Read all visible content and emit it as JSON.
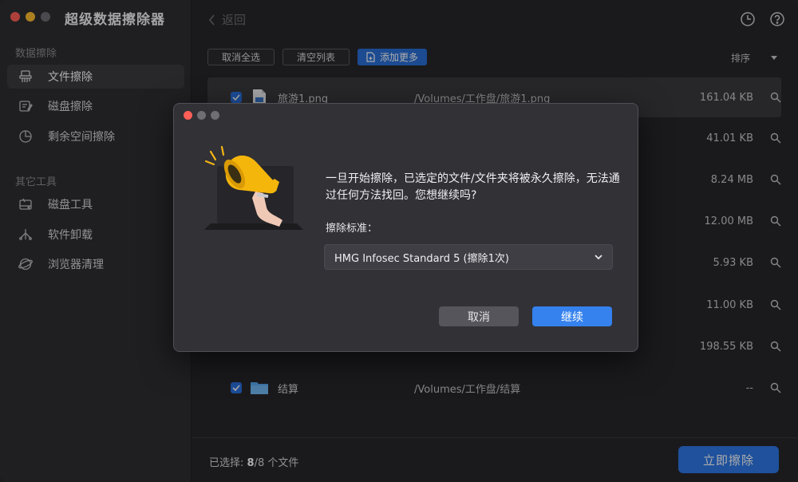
{
  "app": {
    "title": "超级数据擦除器"
  },
  "sidebar": {
    "section1": "数据擦除",
    "items1": [
      {
        "label": "文件擦除",
        "icon": "shredder-icon",
        "active": true
      },
      {
        "label": "磁盘擦除",
        "icon": "disk-erase-icon",
        "active": false
      },
      {
        "label": "剩余空间擦除",
        "icon": "pie-chart-icon",
        "active": false
      }
    ],
    "section2": "其它工具",
    "items2": [
      {
        "label": "磁盘工具",
        "icon": "disk-tool-icon"
      },
      {
        "label": "软件卸载",
        "icon": "uninstall-icon"
      },
      {
        "label": "浏览器清理",
        "icon": "browser-clean-icon"
      }
    ]
  },
  "topbar": {
    "back_label": "返回"
  },
  "toolbar": {
    "deselect_all": "取消全选",
    "clear_list": "清空列表",
    "add_more": "添加更多",
    "sort": "排序"
  },
  "files": [
    {
      "name": "旅游1.png",
      "path": "/Volumes/工作盘/旅游1.png",
      "size": "161.04 KB",
      "type": "image"
    },
    {
      "name": "",
      "path": "",
      "size": "41.01 KB",
      "type": "hidden"
    },
    {
      "name": "",
      "path": "",
      "size": "8.24 MB",
      "type": "hidden"
    },
    {
      "name": "",
      "path": "",
      "size": "12.00 MB",
      "type": "hidden"
    },
    {
      "name": "",
      "path": "",
      "size": "5.93 KB",
      "type": "hidden"
    },
    {
      "name": "",
      "path": "",
      "size": "11.00 KB",
      "type": "hidden"
    },
    {
      "name": "",
      "path": "",
      "size": "198.55 KB",
      "type": "hidden"
    },
    {
      "name": "结算",
      "path": "/Volumes/工作盘/结算",
      "size": "--",
      "type": "folder"
    }
  ],
  "footer": {
    "selected_prefix": "已选择: ",
    "selected_count": "8",
    "selected_suffix": "/8 个文件",
    "erase_button": "立即擦除"
  },
  "dialog": {
    "message": "一旦开始擦除，已选定的文件/文件夹将被永久擦除，无法通过任何方法找回。您想继续吗?",
    "standard_label": "擦除标准：",
    "standard_value": "HMG Infosec Standard 5 (擦除1次)",
    "cancel": "取消",
    "continue": "继续"
  },
  "colors": {
    "accent": "#2f78e6",
    "close": "#ff5f57",
    "minimize": "#febc2e",
    "zoom": "#6e6e73"
  }
}
